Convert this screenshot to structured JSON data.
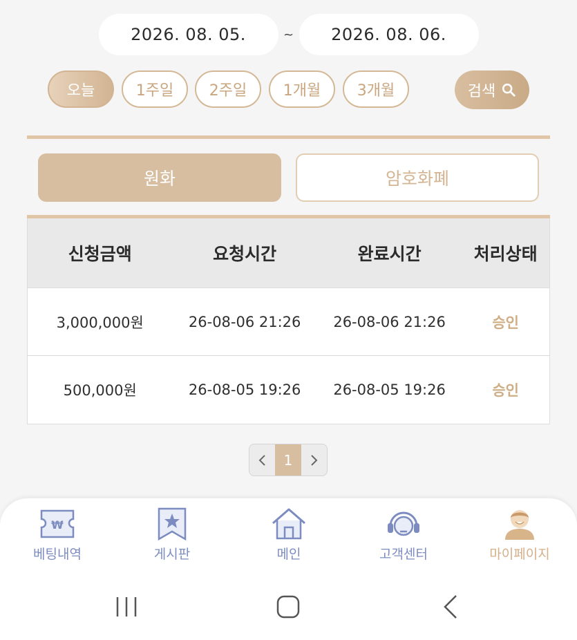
{
  "date_range": {
    "start": "2026. 08. 05.",
    "separator": "~",
    "end": "2026. 08. 06."
  },
  "filters": [
    {
      "label": "오늘",
      "active": true
    },
    {
      "label": "1주일",
      "active": false
    },
    {
      "label": "2주일",
      "active": false
    },
    {
      "label": "1개월",
      "active": false
    },
    {
      "label": "3개월",
      "active": false
    }
  ],
  "search_label": "검색",
  "currency_tabs": [
    {
      "label": "원화",
      "active": true
    },
    {
      "label": "암호화폐",
      "active": false
    }
  ],
  "table": {
    "headers": [
      "신청금액",
      "요청시간",
      "완료시간",
      "처리상태"
    ],
    "rows": [
      [
        "3,000,000원",
        "26-08-06 21:26",
        "26-08-06 21:26",
        "승인"
      ],
      [
        "500,000원",
        "26-08-05 19:26",
        "26-08-05 19:26",
        "승인"
      ]
    ]
  },
  "pagination": {
    "current": "1"
  },
  "bottom_nav": [
    {
      "label": "베팅내역",
      "icon": "ticket-won-icon",
      "active": false
    },
    {
      "label": "게시판",
      "icon": "bookmark-star-icon",
      "active": false
    },
    {
      "label": "메인",
      "icon": "home-icon",
      "active": false
    },
    {
      "label": "고객센터",
      "icon": "headset-icon",
      "active": false
    },
    {
      "label": "마이페이지",
      "icon": "user-avatar-icon",
      "active": true
    }
  ],
  "colors": {
    "accent": "#d8bea0",
    "status": "#cfae86",
    "nav": "#7d8cc0"
  }
}
